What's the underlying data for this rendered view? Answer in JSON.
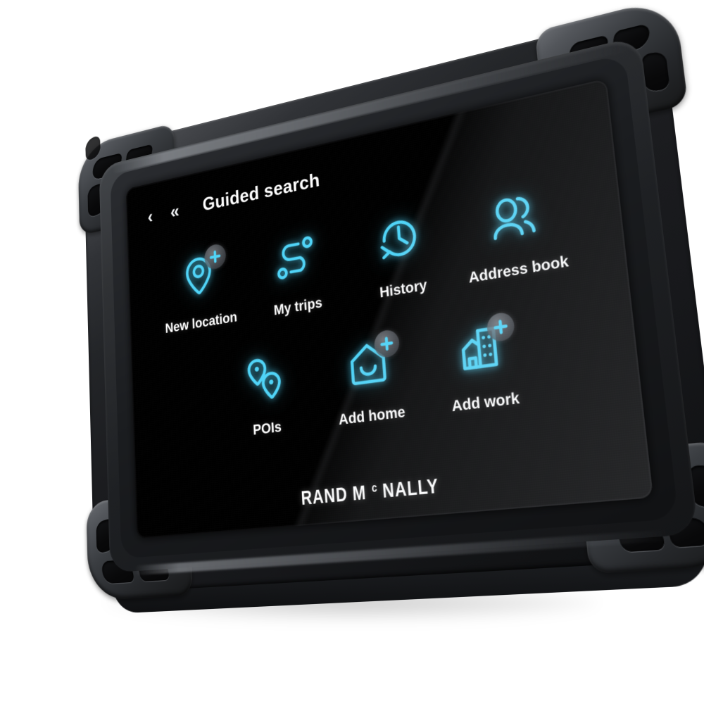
{
  "device": {
    "brand_text": "RAND M",
    "brand_sup": "c",
    "brand_tail": "NALLY",
    "case_color": "#2a2c30",
    "screen_bg": "#000000"
  },
  "screen": {
    "header": {
      "back_icon": "‹",
      "back_all_icon": "«",
      "title": "Guided search"
    },
    "accent_color": "#4fd3f7",
    "label_color": "#ffffff",
    "rows": [
      {
        "row_index": 1,
        "tiles": [
          {
            "id": "new-location",
            "label": "New location",
            "icon": "map-pin-plus-icon",
            "has_plus_badge": true
          },
          {
            "id": "my-trips",
            "label": "My trips",
            "icon": "route-icon",
            "has_plus_badge": false
          },
          {
            "id": "history",
            "label": "History",
            "icon": "clock-rewind-icon",
            "has_plus_badge": false
          },
          {
            "id": "address-book",
            "label": "Address book",
            "icon": "contacts-icon",
            "has_plus_badge": false
          }
        ]
      },
      {
        "row_index": 2,
        "tiles": [
          {
            "id": "pois",
            "label": "POIs",
            "icon": "two-pins-icon",
            "has_plus_badge": false
          },
          {
            "id": "add-home",
            "label": "Add home",
            "icon": "home-plus-icon",
            "has_plus_badge": true
          },
          {
            "id": "add-work",
            "label": "Add work",
            "icon": "building-plus-icon",
            "has_plus_badge": true
          }
        ]
      }
    ]
  }
}
